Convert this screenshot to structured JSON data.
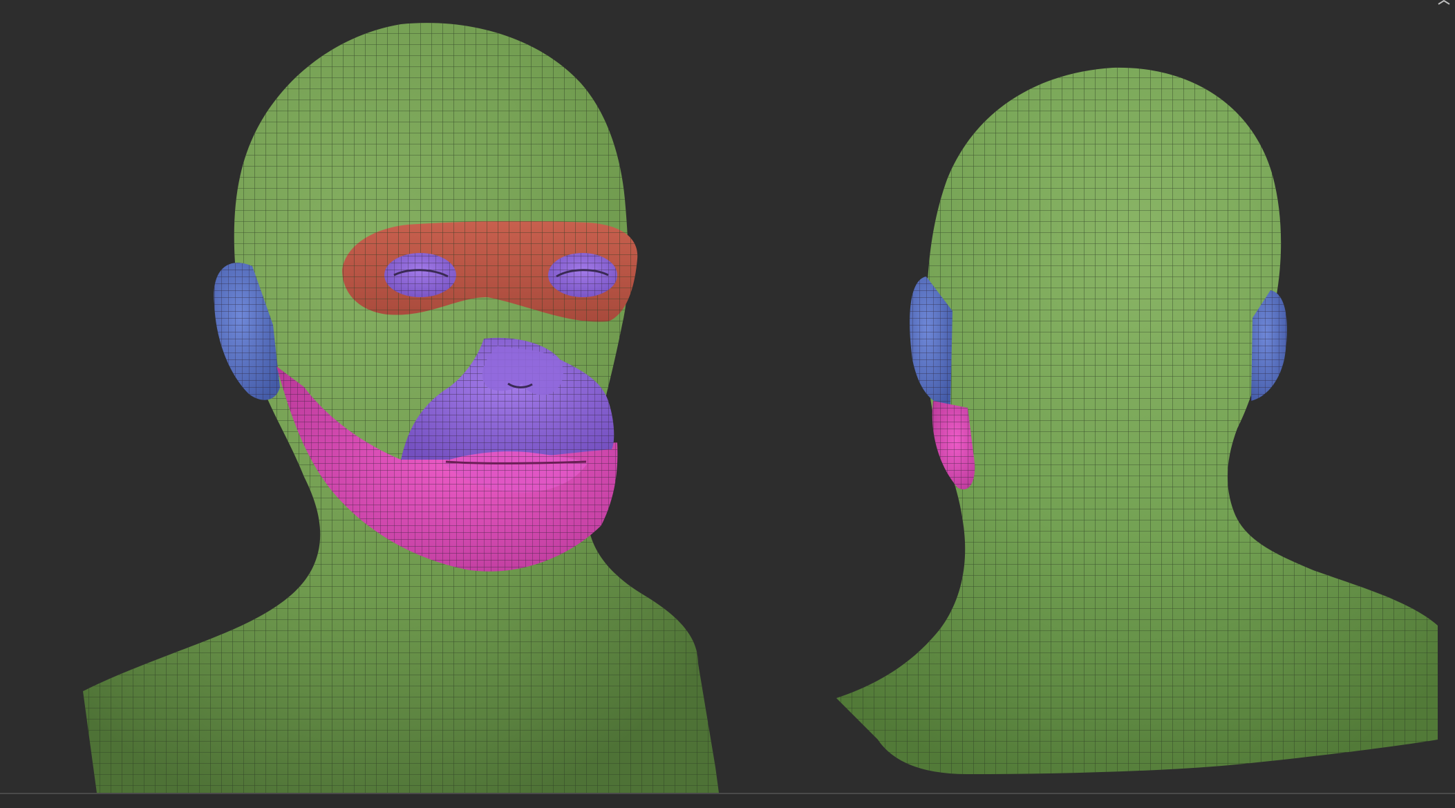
{
  "viewport": {
    "background": "#2d2d2d"
  },
  "models": [
    {
      "name": "head-front-three-quarter",
      "polygroups": [
        {
          "region": "head-neck-shoulders",
          "color": "#6f9a4e"
        },
        {
          "region": "eye-band",
          "color": "#c05a4a"
        },
        {
          "region": "eye-sockets",
          "color": "#8a62d6"
        },
        {
          "region": "nose-mouth-area",
          "color": "#8a5ed8"
        },
        {
          "region": "lower-jaw-chin",
          "color": "#d84bb8"
        },
        {
          "region": "ears",
          "color": "#5a72c2"
        }
      ]
    },
    {
      "name": "head-back-view",
      "polygroups": [
        {
          "region": "head-neck-shoulders",
          "color": "#6f9a4e"
        },
        {
          "region": "ears",
          "color": "#5a72c2"
        },
        {
          "region": "jaw-edge",
          "color": "#d84bb8"
        }
      ]
    }
  ],
  "wireframe": {
    "color": "#2a3a22"
  }
}
